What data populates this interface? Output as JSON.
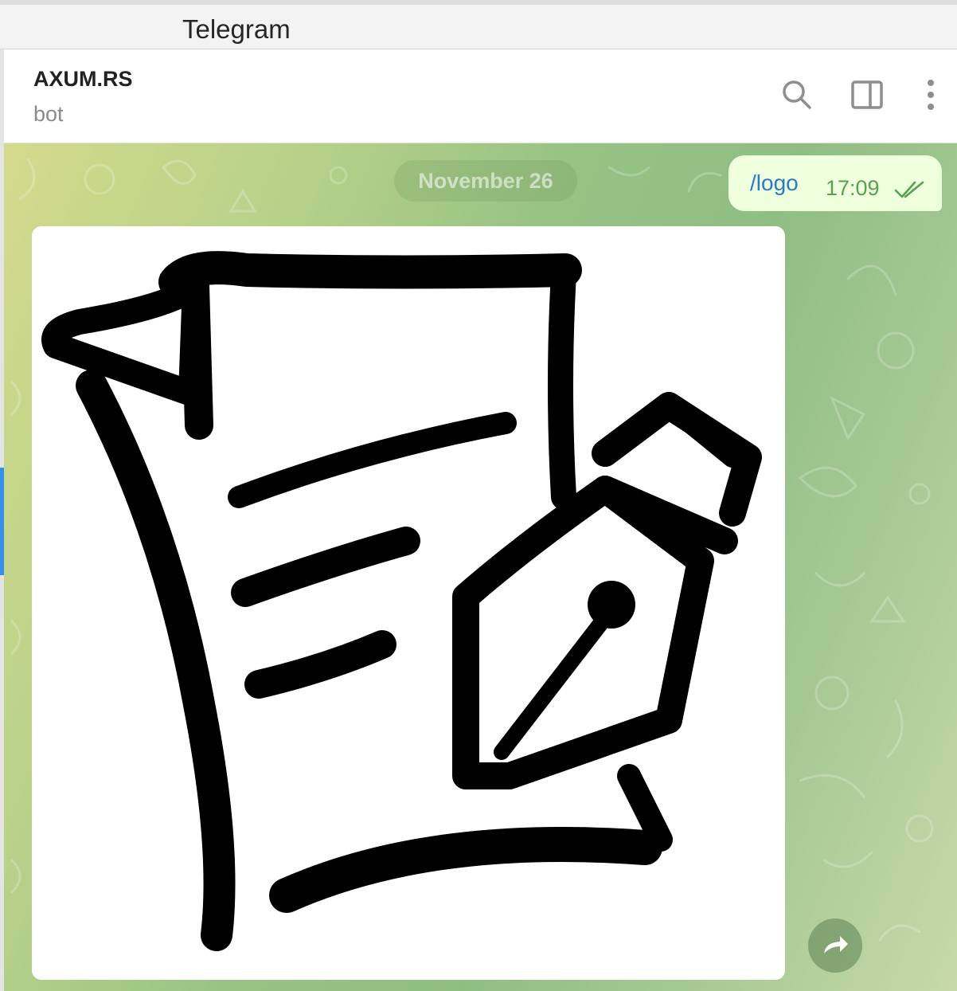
{
  "window": {
    "title": "Telegram"
  },
  "header": {
    "chat_name": "AXUM.RS",
    "chat_status": "bot",
    "icons": [
      "search-icon",
      "sidebar-toggle-icon",
      "more-vertical-icon"
    ]
  },
  "chat": {
    "date_separator": "November 26",
    "messages": [
      {
        "direction": "outgoing",
        "text": "/logo",
        "time": "17:09",
        "status": "read"
      },
      {
        "direction": "incoming",
        "type": "photo",
        "image": "document-with-fountain-pen-logo"
      }
    ],
    "forward_icon": "share-arrow-icon"
  },
  "colors": {
    "outgoing_bubble": "#effedd",
    "command_link": "#2a7bc6",
    "time_read": "#58a24f",
    "accent": "#3390ec"
  }
}
